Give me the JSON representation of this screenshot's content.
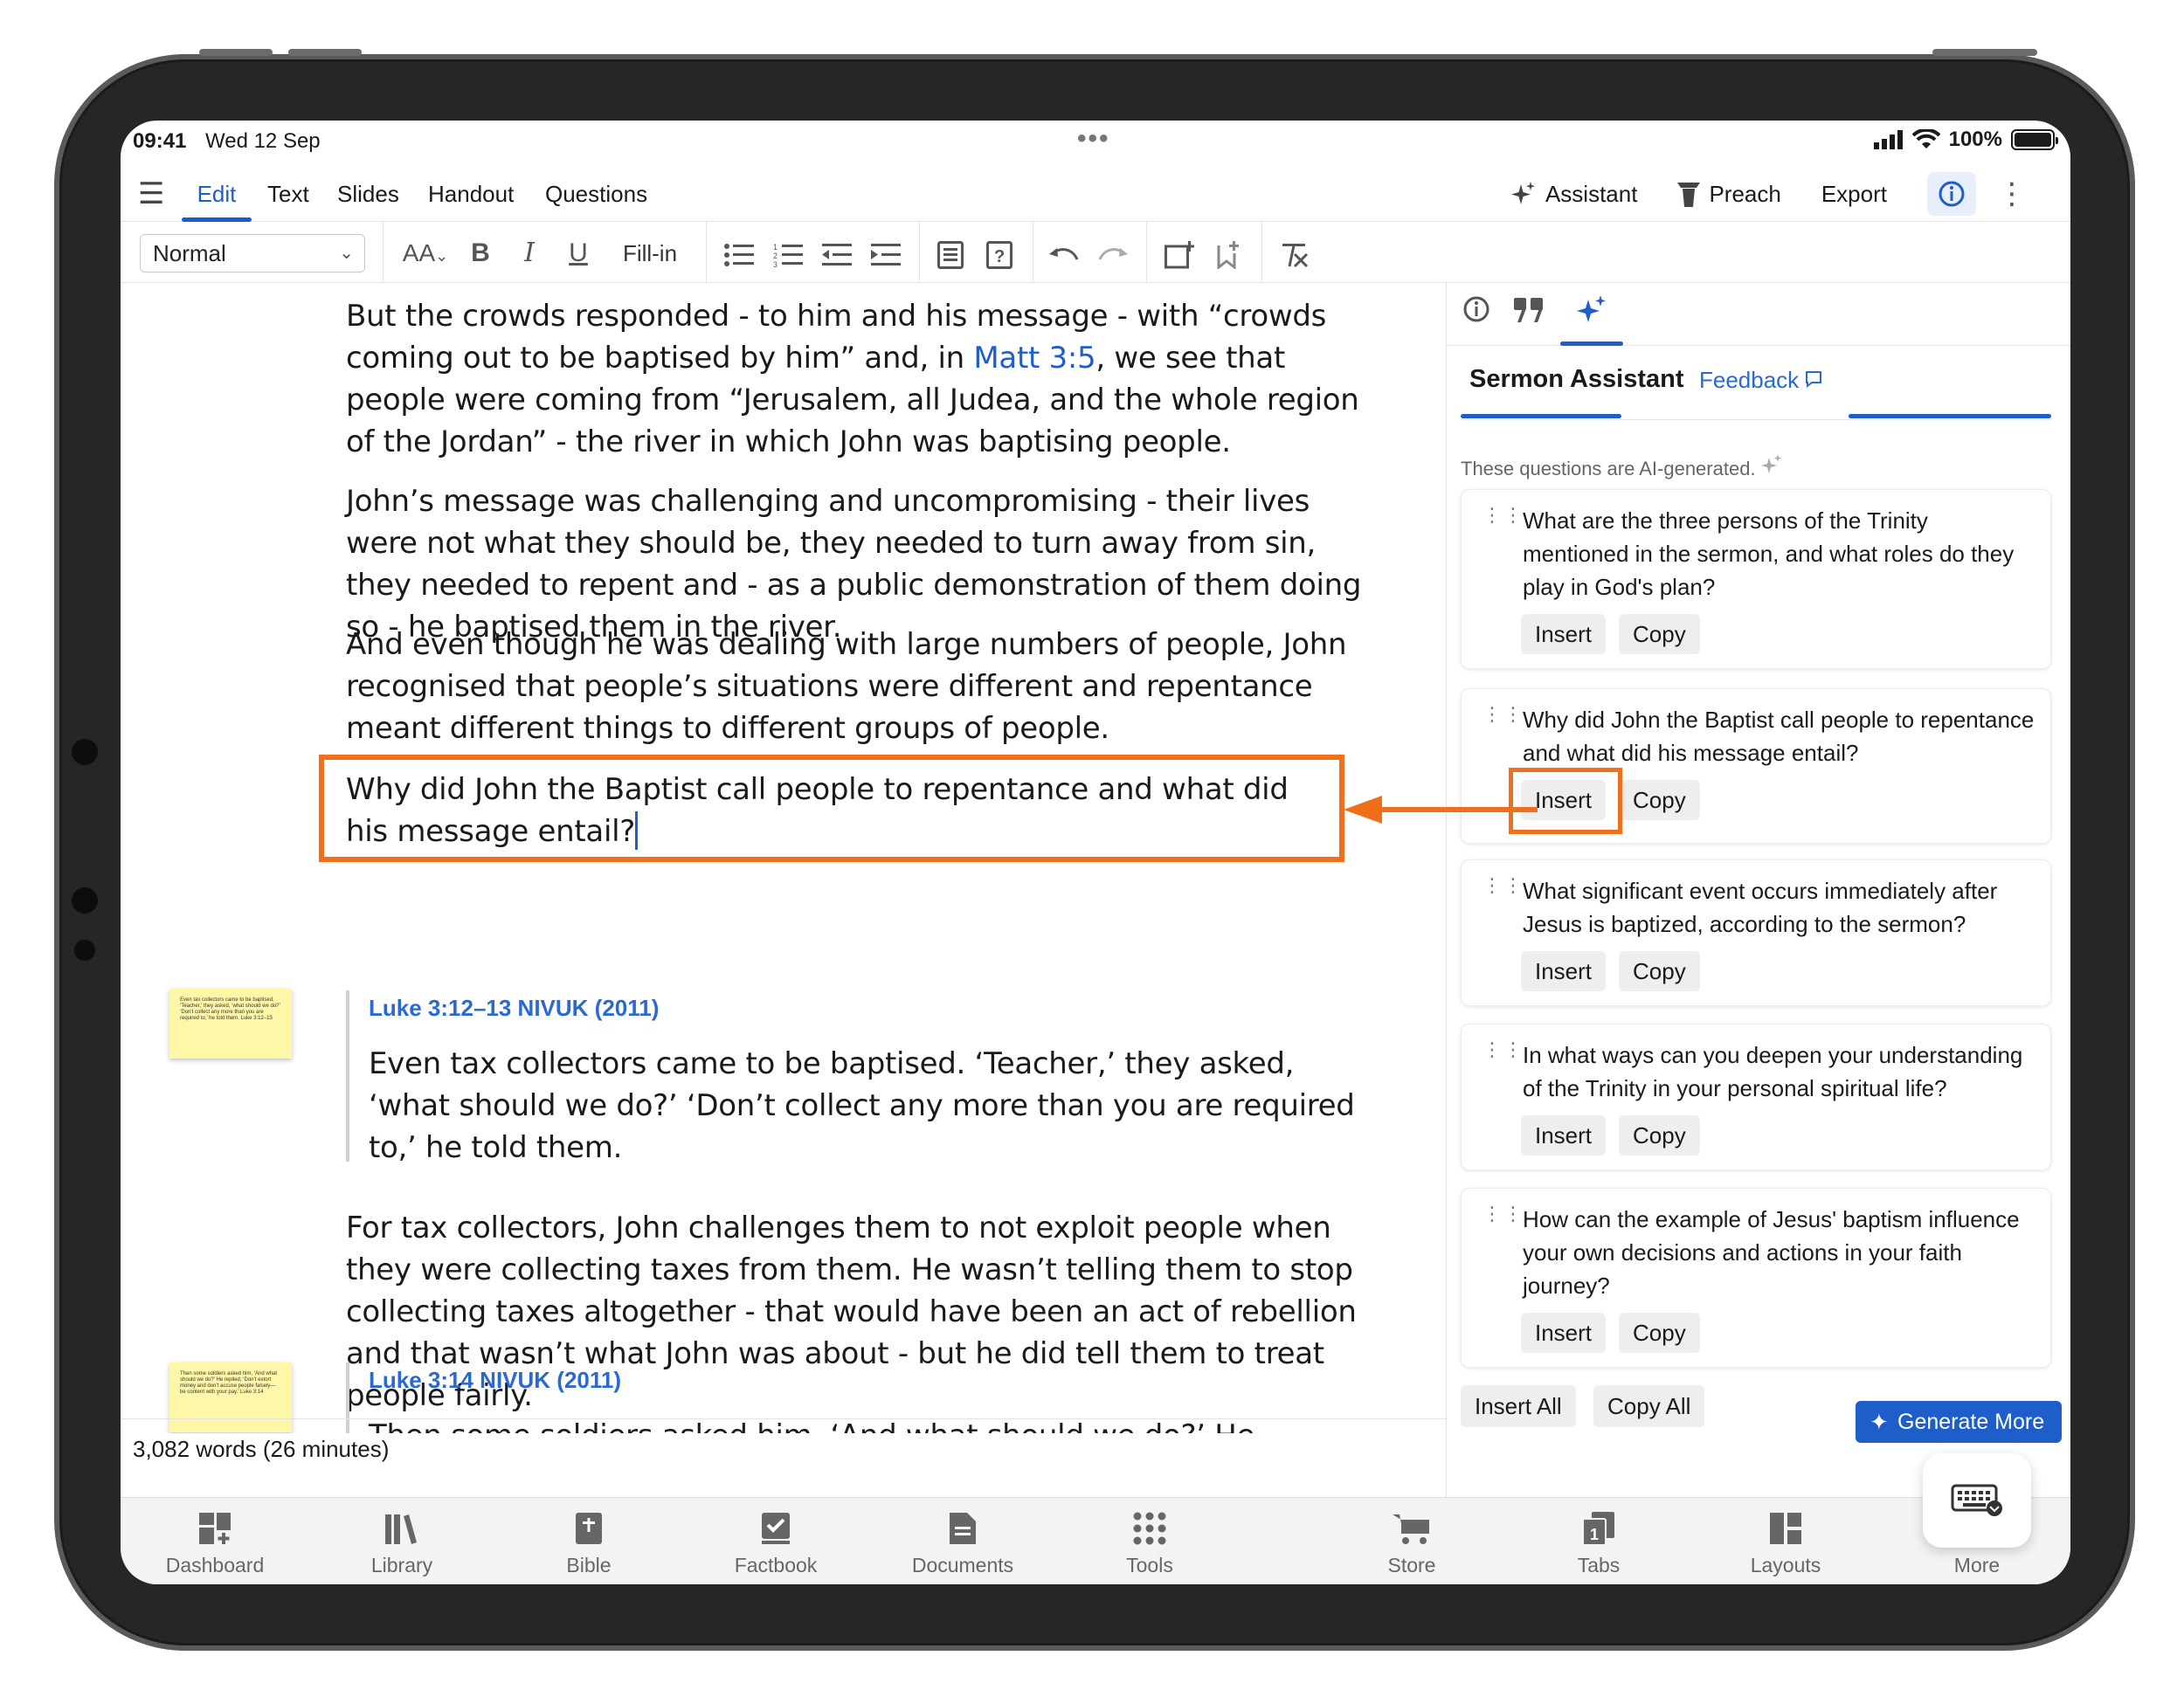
{
  "status_bar": {
    "time": "09:41",
    "date": "Wed 12 Sep",
    "battery": "100%"
  },
  "menu": {
    "items": [
      "Edit",
      "Text",
      "Slides",
      "Handout",
      "Questions"
    ],
    "right": {
      "assistant": "Assistant",
      "preach": "Preach",
      "export": "Export"
    }
  },
  "toolbar": {
    "paragraph_style": "Normal",
    "fill_in": "Fill-in",
    "font_size_icon": "AA"
  },
  "document": {
    "paragraphs": [
      {
        "before_link": "But the crowds responded - to him and his message - with “crowds coming out to be baptised by him” and, in ",
        "link": "Matt 3:5",
        "after_link": ", we see that people were coming from “Jerusalem, all Judea, and the whole region of the Jordan” - the river in which John was baptising people."
      },
      {
        "text": "John’s message was challenging and uncompromising - their lives were not what they should be, they needed to turn away from sin, they needed to repent and - as a public demonstration of them doing so - he baptised them in the river."
      },
      {
        "text": "And even though he was dealing with large numbers of people, John recognised that people’s situations were different and repentance meant different things to different groups of people."
      },
      {
        "text": "Why did John the Baptist call people to repentance and what did his message entail?"
      },
      {
        "text": "For tax collectors, John challenges them to not exploit people when they were collecting taxes from them. He wasn’t telling them to stop collecting taxes altogether - that would have been an act of rebellion and that wasn’t what John was about - but he did tell them to treat people fairly."
      }
    ],
    "quotes": [
      {
        "reference": "Luke 3:12–13 NIVUK (2011)",
        "text": "Even tax collectors came to be baptised. ‘Teacher,’ they asked, ‘what should we do?’ ‘Don’t collect any more than you are required to,’ he told them."
      },
      {
        "reference": "Luke 3:14 NIVUK (2011)",
        "text": "Then some soldiers asked him, ‘And what should we do?’ He replied, ‘Don’t extort money and don’t accuse people falsely—be content with your pay.’"
      }
    ],
    "sticky_notes": [
      "Even tax collectors came to be baptised. ‘Teacher,’ they asked, ‘what should we do?’ ‘Don’t collect any more than you are required to,’ he told them. Luke 3:12–13",
      "Then some soldiers asked him, ‘And what should we do?’ He replied, ‘Don’t extort money and don’t accuse people falsely—be content with your pay.’ Luke 3:14"
    ],
    "word_count": "3,082 words (26 minutes)"
  },
  "panel": {
    "title": "Sermon Assistant",
    "feedback": "Feedback",
    "ai_note": "These questions are AI-generated.",
    "questions": [
      "What are the three persons of the Trinity mentioned in the sermon, and what roles do they play in God's plan?",
      "Why did John the Baptist call people to repentance and what did his message entail?",
      "What significant event occurs immediately after Jesus is baptized, according to the sermon?",
      "In what ways can you deepen your understanding of the Trinity in your personal spiritual life?",
      "How can the example of Jesus' baptism influence your own decisions and actions in your faith journey?"
    ],
    "insert_label": "Insert",
    "copy_label": "Copy",
    "insert_all": "Insert All",
    "copy_all": "Copy All",
    "generate_more": "Generate More"
  },
  "tabbar": [
    "Dashboard",
    "Library",
    "Bible",
    "Factbook",
    "Documents",
    "Tools",
    "Store",
    "Tabs",
    "Layouts",
    "More"
  ],
  "colors": {
    "accent": "#1e5ec8",
    "highlight": "#ef6f1a",
    "sticky": "#fff7a8"
  }
}
